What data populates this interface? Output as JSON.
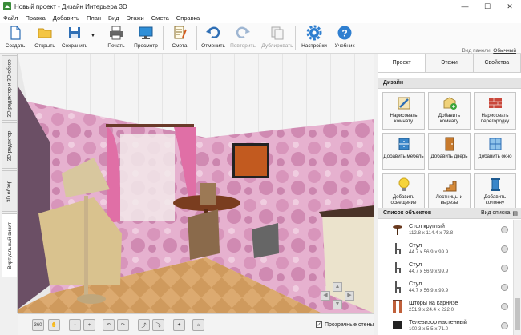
{
  "window": {
    "title": "Новый проект - Дизайн Интерьера 3D",
    "minimize": "—",
    "maximize": "☐",
    "close": "✕"
  },
  "menu": [
    "Файл",
    "Правка",
    "Добавить",
    "План",
    "Вид",
    "Этажи",
    "Смета",
    "Справка"
  ],
  "toolbar": {
    "save_small": "Создать",
    "open": "Открыть",
    "save": "Сохранить",
    "print": "Печать",
    "preview": "Просмотр",
    "estimate": "Смета",
    "undo": "Отменить",
    "redo": "Повторить",
    "duplicate": "Дублировать",
    "settings": "Настройки",
    "tutorial": "Учебник",
    "panel_view_label": "Вид панели:",
    "panel_view_value": "Обычный"
  },
  "side_tabs": [
    "2D редактор и 3D обзор",
    "2D редактор",
    "3D обзор",
    "Виртуальный визит"
  ],
  "bottom": {
    "transparent_walls": "Прозрачные стены",
    "btn_360": "360"
  },
  "right_panel": {
    "tabs": [
      "Проект",
      "Этажи",
      "Свойства"
    ],
    "design_header": "Дизайн",
    "buttons": [
      "Нарисовать комнату",
      "Добавить комнату",
      "Нарисовать перегородку",
      "Добавить мебель",
      "Добавить дверь",
      "Добавить окно",
      "Добавить освещение",
      "Лестницы и вырезы",
      "Добавить колонну"
    ],
    "objects_header": "Список объектов",
    "view_list": "Вид списка",
    "objects": [
      {
        "name": "Стол круглый",
        "dims": "112.8 x 114.4 x 73.8"
      },
      {
        "name": "Стул",
        "dims": "44.7 x 56.9 x 99.9"
      },
      {
        "name": "Стул",
        "dims": "44.7 x 56.9 x 99.9"
      },
      {
        "name": "Стул",
        "dims": "44.7 x 56.9 x 99.9"
      },
      {
        "name": "Шторы на карнизе",
        "dims": "251.9 x 24.4 x 222.0"
      },
      {
        "name": "Телевизор настенный",
        "dims": "100.3 x 5.5 x 71.0"
      }
    ]
  },
  "colors": {
    "accent_blue": "#2f6fb5",
    "wall_pink": "#e4a9c8",
    "floor_wood": "#d9a66b"
  }
}
